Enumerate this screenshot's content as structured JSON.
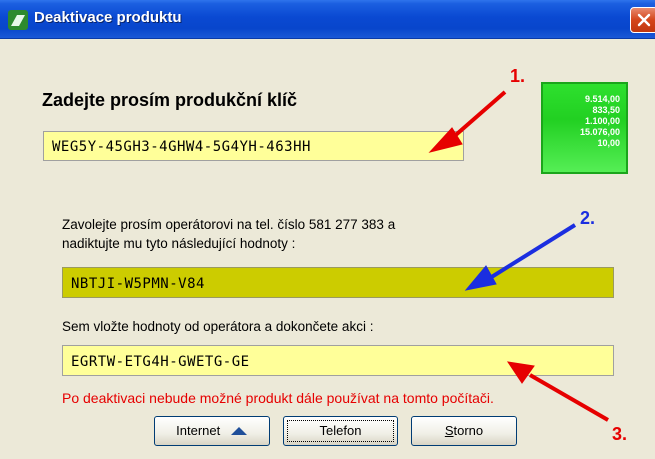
{
  "window": {
    "title": "Deaktivace produktu"
  },
  "heading": "Zadejte prosím produkční klíč",
  "product_key": "WEG5Y-45GH3-4GHW4-5G4YH-463HH",
  "ticker_values": [
    "9.514,00",
    "833,50",
    "1.100,00",
    "15.076,00",
    "10,00"
  ],
  "instructions": {
    "line1": "Zavolejte prosím operátorovi na tel. číslo 581 277 383 a",
    "line2": "nadiktujte mu tyto následující hodnoty :"
  },
  "installation_code": "NBTJI-W5PMN-V84",
  "paste_label": "Sem vložte hodnoty od operátora a dokončete akci :",
  "confirmation_code": "EGRTW-ETG4H-GWETG-GE",
  "warning": "Po deaktivaci nebude možné produkt dále používat na tomto počítači.",
  "buttons": {
    "internet": "Internet",
    "telefon": "Telefon",
    "storno_first": "S",
    "storno_rest": "torno"
  },
  "annotations": {
    "n1": "1.",
    "n2": "2.",
    "n3": "3."
  },
  "colors": {
    "title_bar": "#0a49d2",
    "field_yellow": "#ffff99",
    "code_olive": "#cccc00",
    "warning_red": "#e60000",
    "arrow_red": "#e60000",
    "arrow_blue": "#1b2ee0",
    "ticker_green": "#22d022"
  },
  "icons": [
    "app-icon",
    "close-icon",
    "triangle-up-icon"
  ]
}
